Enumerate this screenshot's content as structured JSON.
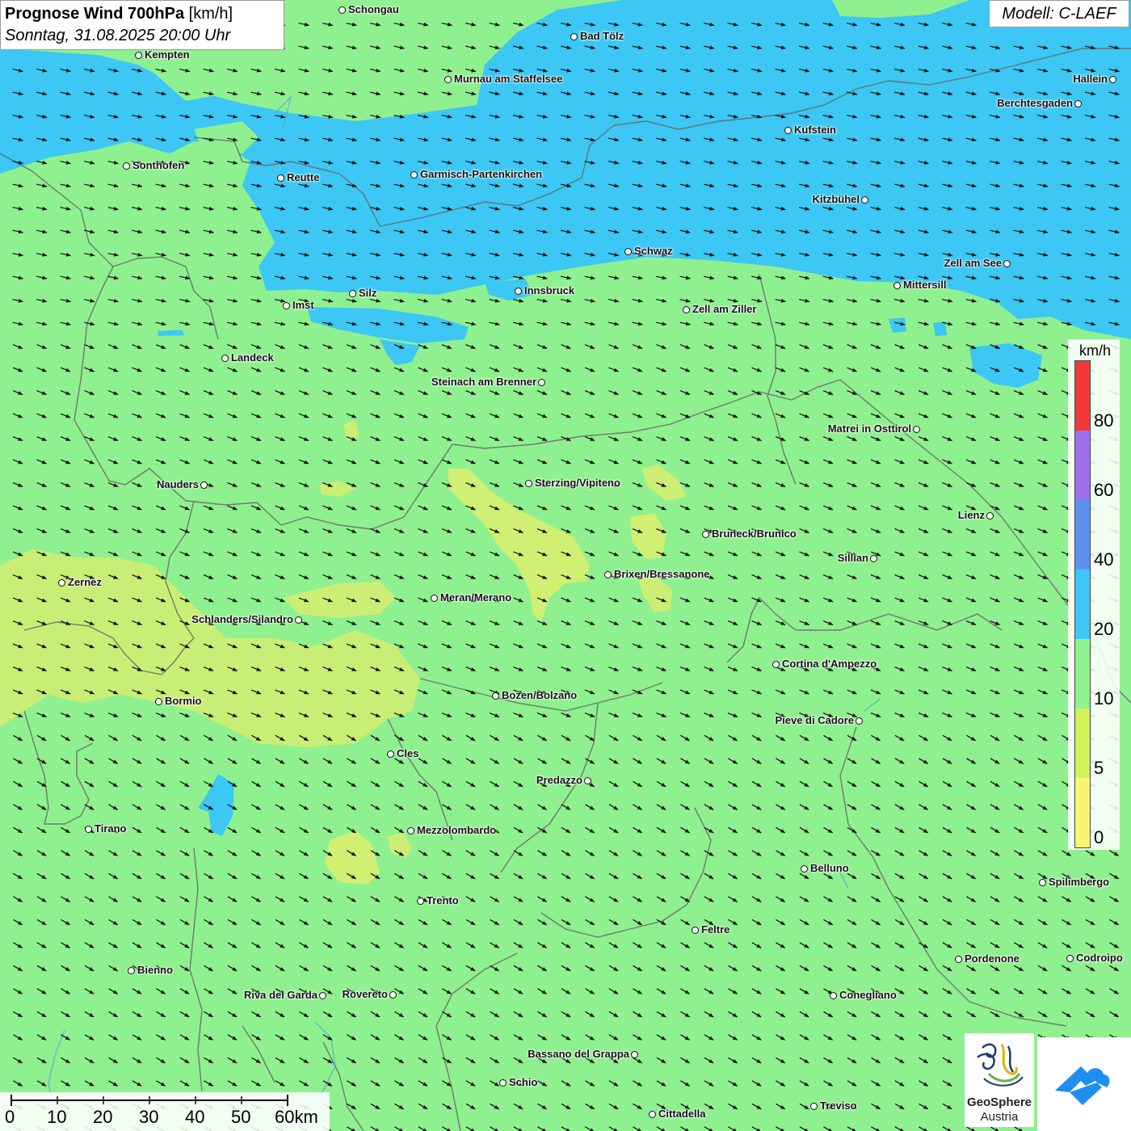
{
  "title": {
    "bold": "Prognose Wind 700hPa",
    "unit": "[km/h]",
    "datetime": "Sonntag, 31.08.2025 20:00 Uhr"
  },
  "model": "Modell: C-LAEF",
  "colors": {
    "land_green": "#8ff08f",
    "blue_20_40": "#3cc7f5",
    "yellow_5_10": "#dcee6e",
    "yellow_0_5": "#f7f77a"
  },
  "legend": {
    "unit": "km/h",
    "classes": [
      {
        "from": 80,
        "to": 100,
        "color": "#f03a3a"
      },
      {
        "from": 60,
        "to": 80,
        "color": "#a070ee"
      },
      {
        "from": 40,
        "to": 60,
        "color": "#5f92f0"
      },
      {
        "from": 20,
        "to": 40,
        "color": "#3cc7f5"
      },
      {
        "from": 10,
        "to": 20,
        "color": "#8ef28e"
      },
      {
        "from": 5,
        "to": 10,
        "color": "#d2f25a"
      },
      {
        "from": 0,
        "to": 5,
        "color": "#f8f570"
      }
    ],
    "labels": [
      "80",
      "60",
      "40",
      "20",
      "10",
      "5",
      "0"
    ]
  },
  "scalebar": {
    "labels": [
      "0",
      "10",
      "20",
      "30",
      "40",
      "50",
      "60km"
    ]
  },
  "cities": [
    {
      "name": "Schongau"
    },
    {
      "name": "Bad Tölz"
    },
    {
      "name": "Kempten"
    },
    {
      "name": "Murnau am Staffelsee"
    },
    {
      "name": "Hallein"
    },
    {
      "name": "Berchtesgaden"
    },
    {
      "name": "Kufstein"
    },
    {
      "name": "Sonthofen"
    },
    {
      "name": "Reutte"
    },
    {
      "name": "Garmisch-Partenkirchen"
    },
    {
      "name": "Kitzbühel"
    },
    {
      "name": "Schwaz"
    },
    {
      "name": "Zell am See"
    },
    {
      "name": "Mittersill"
    },
    {
      "name": "Silz"
    },
    {
      "name": "Innsbruck"
    },
    {
      "name": "Imst"
    },
    {
      "name": "Zell am Ziller"
    },
    {
      "name": "Landeck"
    },
    {
      "name": "Steinach am Brenner"
    },
    {
      "name": "Matrei in Osttirol"
    },
    {
      "name": "Nauders"
    },
    {
      "name": "Sterzing/Vipiteno"
    },
    {
      "name": "Lienz"
    },
    {
      "name": "Bruneck/Brunico"
    },
    {
      "name": "Sillian"
    },
    {
      "name": "Zernez"
    },
    {
      "name": "Brixen/Bressanone"
    },
    {
      "name": "Meran/Merano"
    },
    {
      "name": "Schlanders/Silandro"
    },
    {
      "name": "Cortina d'Ampezzo"
    },
    {
      "name": "Bozen/Bolzano"
    },
    {
      "name": "Bormio"
    },
    {
      "name": "Pieve di Cadore"
    },
    {
      "name": "Cles"
    },
    {
      "name": "Predazzo"
    },
    {
      "name": "Tirano"
    },
    {
      "name": "Mezzolombardo"
    },
    {
      "name": "Belluno"
    },
    {
      "name": "Spilimbergo"
    },
    {
      "name": "Trento"
    },
    {
      "name": "Feltre"
    },
    {
      "name": "Pordenone"
    },
    {
      "name": "Codroipo"
    },
    {
      "name": "Bienno"
    },
    {
      "name": "Riva del Garda"
    },
    {
      "name": "Rovereto"
    },
    {
      "name": "Conegliano"
    },
    {
      "name": "Bassano del Grappa"
    },
    {
      "name": "Schio"
    },
    {
      "name": "Treviso"
    },
    {
      "name": "Cittadella"
    }
  ],
  "logos": {
    "geosphere_name": "GeoSphere",
    "geosphere_sub": "Austria"
  },
  "wind": {
    "direction": "from west-northwest"
  }
}
